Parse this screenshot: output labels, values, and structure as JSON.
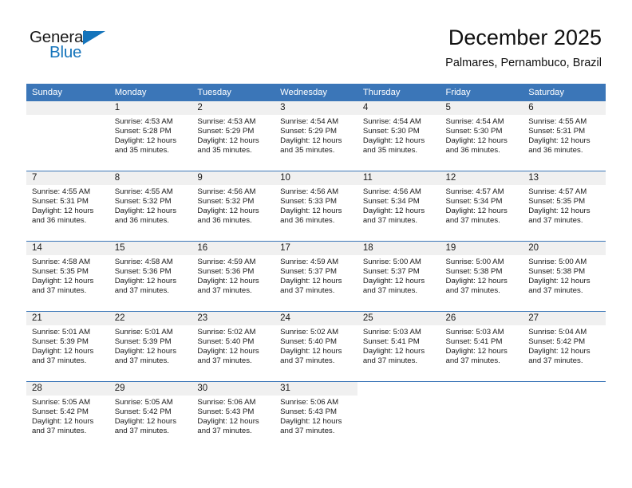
{
  "brand": {
    "name_part1": "General",
    "name_part2": "Blue",
    "triangle_icon": "triangle-icon",
    "accent_color": "#1574bb"
  },
  "header": {
    "title": "December 2025",
    "location": "Palmares, Pernambuco, Brazil"
  },
  "theme": {
    "header_blue": "#3b76b8",
    "daynum_background": "#f0f0f0",
    "text_color": "#1a1a1a"
  },
  "weekday_headers": [
    "Sunday",
    "Monday",
    "Tuesday",
    "Wednesday",
    "Thursday",
    "Friday",
    "Saturday"
  ],
  "labels": {
    "sunrise_prefix": "Sunrise:",
    "sunset_prefix": "Sunset:",
    "daylight_prefix": "Daylight:"
  },
  "weeks": [
    [
      {
        "day": "",
        "empty": true
      },
      {
        "day": "1",
        "sunrise": "Sunrise: 4:53 AM",
        "sunset": "Sunset: 5:28 PM",
        "daylight_line1": "Daylight: 12 hours",
        "daylight_line2": "and 35 minutes."
      },
      {
        "day": "2",
        "sunrise": "Sunrise: 4:53 AM",
        "sunset": "Sunset: 5:29 PM",
        "daylight_line1": "Daylight: 12 hours",
        "daylight_line2": "and 35 minutes."
      },
      {
        "day": "3",
        "sunrise": "Sunrise: 4:54 AM",
        "sunset": "Sunset: 5:29 PM",
        "daylight_line1": "Daylight: 12 hours",
        "daylight_line2": "and 35 minutes."
      },
      {
        "day": "4",
        "sunrise": "Sunrise: 4:54 AM",
        "sunset": "Sunset: 5:30 PM",
        "daylight_line1": "Daylight: 12 hours",
        "daylight_line2": "and 35 minutes."
      },
      {
        "day": "5",
        "sunrise": "Sunrise: 4:54 AM",
        "sunset": "Sunset: 5:30 PM",
        "daylight_line1": "Daylight: 12 hours",
        "daylight_line2": "and 36 minutes."
      },
      {
        "day": "6",
        "sunrise": "Sunrise: 4:55 AM",
        "sunset": "Sunset: 5:31 PM",
        "daylight_line1": "Daylight: 12 hours",
        "daylight_line2": "and 36 minutes."
      }
    ],
    [
      {
        "day": "7",
        "sunrise": "Sunrise: 4:55 AM",
        "sunset": "Sunset: 5:31 PM",
        "daylight_line1": "Daylight: 12 hours",
        "daylight_line2": "and 36 minutes."
      },
      {
        "day": "8",
        "sunrise": "Sunrise: 4:55 AM",
        "sunset": "Sunset: 5:32 PM",
        "daylight_line1": "Daylight: 12 hours",
        "daylight_line2": "and 36 minutes."
      },
      {
        "day": "9",
        "sunrise": "Sunrise: 4:56 AM",
        "sunset": "Sunset: 5:32 PM",
        "daylight_line1": "Daylight: 12 hours",
        "daylight_line2": "and 36 minutes."
      },
      {
        "day": "10",
        "sunrise": "Sunrise: 4:56 AM",
        "sunset": "Sunset: 5:33 PM",
        "daylight_line1": "Daylight: 12 hours",
        "daylight_line2": "and 36 minutes."
      },
      {
        "day": "11",
        "sunrise": "Sunrise: 4:56 AM",
        "sunset": "Sunset: 5:34 PM",
        "daylight_line1": "Daylight: 12 hours",
        "daylight_line2": "and 37 minutes."
      },
      {
        "day": "12",
        "sunrise": "Sunrise: 4:57 AM",
        "sunset": "Sunset: 5:34 PM",
        "daylight_line1": "Daylight: 12 hours",
        "daylight_line2": "and 37 minutes."
      },
      {
        "day": "13",
        "sunrise": "Sunrise: 4:57 AM",
        "sunset": "Sunset: 5:35 PM",
        "daylight_line1": "Daylight: 12 hours",
        "daylight_line2": "and 37 minutes."
      }
    ],
    [
      {
        "day": "14",
        "sunrise": "Sunrise: 4:58 AM",
        "sunset": "Sunset: 5:35 PM",
        "daylight_line1": "Daylight: 12 hours",
        "daylight_line2": "and 37 minutes."
      },
      {
        "day": "15",
        "sunrise": "Sunrise: 4:58 AM",
        "sunset": "Sunset: 5:36 PM",
        "daylight_line1": "Daylight: 12 hours",
        "daylight_line2": "and 37 minutes."
      },
      {
        "day": "16",
        "sunrise": "Sunrise: 4:59 AM",
        "sunset": "Sunset: 5:36 PM",
        "daylight_line1": "Daylight: 12 hours",
        "daylight_line2": "and 37 minutes."
      },
      {
        "day": "17",
        "sunrise": "Sunrise: 4:59 AM",
        "sunset": "Sunset: 5:37 PM",
        "daylight_line1": "Daylight: 12 hours",
        "daylight_line2": "and 37 minutes."
      },
      {
        "day": "18",
        "sunrise": "Sunrise: 5:00 AM",
        "sunset": "Sunset: 5:37 PM",
        "daylight_line1": "Daylight: 12 hours",
        "daylight_line2": "and 37 minutes."
      },
      {
        "day": "19",
        "sunrise": "Sunrise: 5:00 AM",
        "sunset": "Sunset: 5:38 PM",
        "daylight_line1": "Daylight: 12 hours",
        "daylight_line2": "and 37 minutes."
      },
      {
        "day": "20",
        "sunrise": "Sunrise: 5:00 AM",
        "sunset": "Sunset: 5:38 PM",
        "daylight_line1": "Daylight: 12 hours",
        "daylight_line2": "and 37 minutes."
      }
    ],
    [
      {
        "day": "21",
        "sunrise": "Sunrise: 5:01 AM",
        "sunset": "Sunset: 5:39 PM",
        "daylight_line1": "Daylight: 12 hours",
        "daylight_line2": "and 37 minutes."
      },
      {
        "day": "22",
        "sunrise": "Sunrise: 5:01 AM",
        "sunset": "Sunset: 5:39 PM",
        "daylight_line1": "Daylight: 12 hours",
        "daylight_line2": "and 37 minutes."
      },
      {
        "day": "23",
        "sunrise": "Sunrise: 5:02 AM",
        "sunset": "Sunset: 5:40 PM",
        "daylight_line1": "Daylight: 12 hours",
        "daylight_line2": "and 37 minutes."
      },
      {
        "day": "24",
        "sunrise": "Sunrise: 5:02 AM",
        "sunset": "Sunset: 5:40 PM",
        "daylight_line1": "Daylight: 12 hours",
        "daylight_line2": "and 37 minutes."
      },
      {
        "day": "25",
        "sunrise": "Sunrise: 5:03 AM",
        "sunset": "Sunset: 5:41 PM",
        "daylight_line1": "Daylight: 12 hours",
        "daylight_line2": "and 37 minutes."
      },
      {
        "day": "26",
        "sunrise": "Sunrise: 5:03 AM",
        "sunset": "Sunset: 5:41 PM",
        "daylight_line1": "Daylight: 12 hours",
        "daylight_line2": "and 37 minutes."
      },
      {
        "day": "27",
        "sunrise": "Sunrise: 5:04 AM",
        "sunset": "Sunset: 5:42 PM",
        "daylight_line1": "Daylight: 12 hours",
        "daylight_line2": "and 37 minutes."
      }
    ],
    [
      {
        "day": "28",
        "sunrise": "Sunrise: 5:05 AM",
        "sunset": "Sunset: 5:42 PM",
        "daylight_line1": "Daylight: 12 hours",
        "daylight_line2": "and 37 minutes."
      },
      {
        "day": "29",
        "sunrise": "Sunrise: 5:05 AM",
        "sunset": "Sunset: 5:42 PM",
        "daylight_line1": "Daylight: 12 hours",
        "daylight_line2": "and 37 minutes."
      },
      {
        "day": "30",
        "sunrise": "Sunrise: 5:06 AM",
        "sunset": "Sunset: 5:43 PM",
        "daylight_line1": "Daylight: 12 hours",
        "daylight_line2": "and 37 minutes."
      },
      {
        "day": "31",
        "sunrise": "Sunrise: 5:06 AM",
        "sunset": "Sunset: 5:43 PM",
        "daylight_line1": "Daylight: 12 hours",
        "daylight_line2": "and 37 minutes."
      },
      {
        "day": "",
        "blank": true
      },
      {
        "day": "",
        "blank": true
      },
      {
        "day": "",
        "blank": true
      }
    ]
  ]
}
